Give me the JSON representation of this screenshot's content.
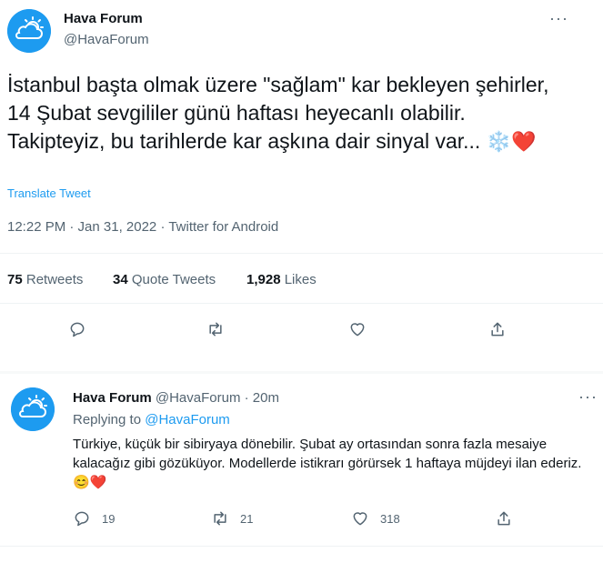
{
  "colors": {
    "accent": "#1d9bf0",
    "heart": "#e0245e",
    "text": "#0f1419",
    "muted": "#536471"
  },
  "main_tweet": {
    "author_name": "Hava Forum",
    "author_handle": "@HavaForum",
    "text": "İstanbul başta olmak üzere \"sağlam\" kar bekleyen şehirler, 14 Şubat sevgililer günü haftası heyecanlı olabilir. Takipteyiz, bu tarihlerde kar aşkına dair sinyal var... ",
    "emoji": "❄️❤️",
    "translate": "Translate Tweet",
    "time": "12:22 PM · Jan 31, 2022 · ",
    "client": "Twitter for Android",
    "stats": {
      "retweets_count": "75",
      "retweets_label": "Retweets",
      "quotes_count": "34",
      "quotes_label": "Quote Tweets",
      "likes_count": "1,928",
      "likes_label": "Likes"
    },
    "actions": [
      "reply-icon",
      "retweet-icon",
      "like-icon",
      "share-icon"
    ]
  },
  "reply": {
    "author_name": "Hava Forum",
    "author_handle": "@HavaForum",
    "time": " · 20m",
    "replying_label": "Replying to ",
    "replying_handle": "@HavaForum",
    "text": "Türkiye, küçük bir sibiryaya dönebilir. Şubat ay ortasından sonra fazla mesaiye kalacağız gibi gözüküyor. Modellerde istikrarı görürsek 1 haftaya müjdeyi ilan ederiz. ",
    "emoji": "😊❤️",
    "reply_count": "19",
    "retweet_count": "21",
    "like_count": "318"
  }
}
